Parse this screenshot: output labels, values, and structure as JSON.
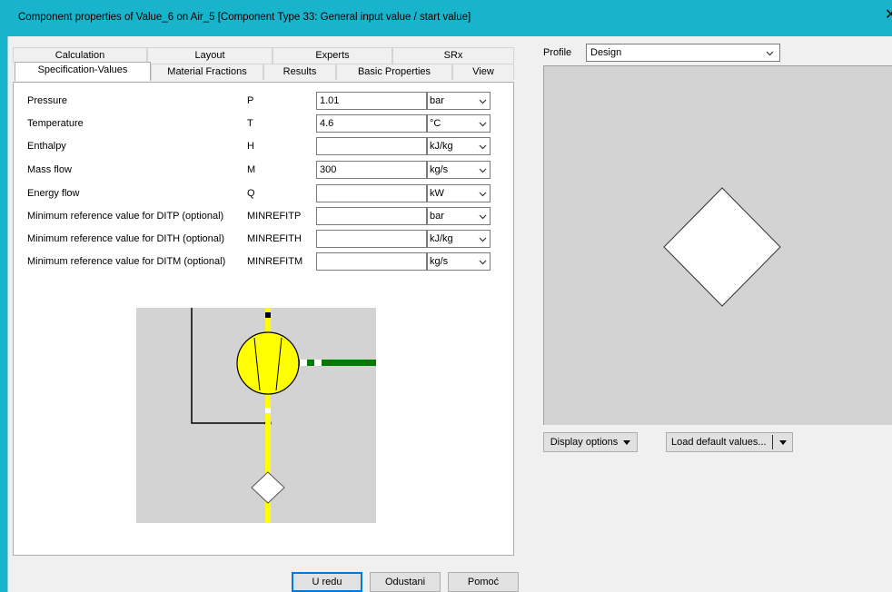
{
  "window": {
    "title": "Component properties of Value_6 on Air_5  [Component Type 33: General input value / start value]",
    "close_label": "✕"
  },
  "tabs": {
    "row1": [
      "Calculation",
      "Layout",
      "Experts",
      "SRx"
    ],
    "row2": [
      "Specification-Values",
      "Material Fractions",
      "Results",
      "Basic Properties",
      "View"
    ],
    "active": "Specification-Values"
  },
  "specs": [
    {
      "label": "Pressure",
      "symbol": "P",
      "value": "1.01",
      "unit": "bar"
    },
    {
      "label": "Temperature",
      "symbol": "T",
      "value": "4.6",
      "unit": "°C"
    },
    {
      "label": "Enthalpy",
      "symbol": "H",
      "value": "",
      "unit": "kJ/kg"
    },
    {
      "label": "Mass flow",
      "symbol": "M",
      "value": "300",
      "unit": "kg/s"
    },
    {
      "label": "Energy flow",
      "symbol": "Q",
      "value": "",
      "unit": "kW"
    },
    {
      "label": "Minimum reference value for DITP (optional)",
      "symbol": "MINREFITP",
      "value": "",
      "unit": "bar"
    },
    {
      "label": "Minimum reference value for DITH (optional)",
      "symbol": "MINREFITH",
      "value": "",
      "unit": "kJ/kg"
    },
    {
      "label": "Minimum reference value for DITM (optional)",
      "symbol": "MINREFITM",
      "value": "",
      "unit": "kg/s"
    }
  ],
  "profile": {
    "label": "Profile",
    "value": "Design"
  },
  "buttons": {
    "display_options": "Display options",
    "load_defaults": "Load default values...",
    "ok": "U redu",
    "cancel": "Odustani",
    "help": "Pomoć"
  },
  "colors": {
    "titlebar": "#17b4cc",
    "pipe_yellow": "#ffff00",
    "pipe_green": "#007a00",
    "preview_bg": "#d3d3d3"
  },
  "icons": {
    "dropdown": "chevron-down-icon",
    "menu_arrow": "triangle-down-icon",
    "component": "diamond-icon",
    "compressor": "compressor-icon"
  }
}
